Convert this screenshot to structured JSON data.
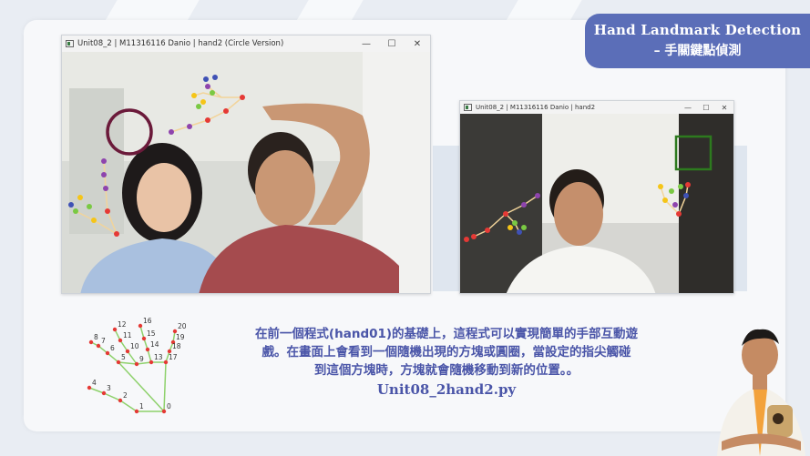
{
  "title": {
    "line1": "Hand Landmark Detection",
    "line2": "– 手關鍵點偵測"
  },
  "window_left": {
    "title": "Unit08_2 | M11316116 Danio | hand2 (Circle Version)",
    "icon": "opencv-window-icon"
  },
  "window_right": {
    "title": "Unit08_2 | M11316116 Danio | hand2",
    "icon": "opencv-window-icon"
  },
  "window_controls": {
    "minimize": "—",
    "maximize": "☐",
    "close": "✕"
  },
  "hand_diagram": {
    "labels": [
      "0",
      "1",
      "2",
      "3",
      "4",
      "5",
      "6",
      "7",
      "8",
      "9",
      "10",
      "11",
      "12",
      "13",
      "14",
      "15",
      "16",
      "17",
      "18",
      "19",
      "20"
    ]
  },
  "description": {
    "line1": "在前一個程式(hand01)的基礎上，這程式可以實現簡單的手部互動遊",
    "line2": "戲。在畫面上會看到一個隨機出現的方塊或圓圈，當設定的指尖觸碰",
    "line3": "到這個方塊時，方塊就會隨機移動到新的位置。。",
    "filename": "Unit08_2hand2.py"
  },
  "colors": {
    "accent": "#5b6eb8",
    "text": "#4a55a8",
    "target_circle": "#6b1a3a",
    "target_square": "#2d7a1e"
  }
}
